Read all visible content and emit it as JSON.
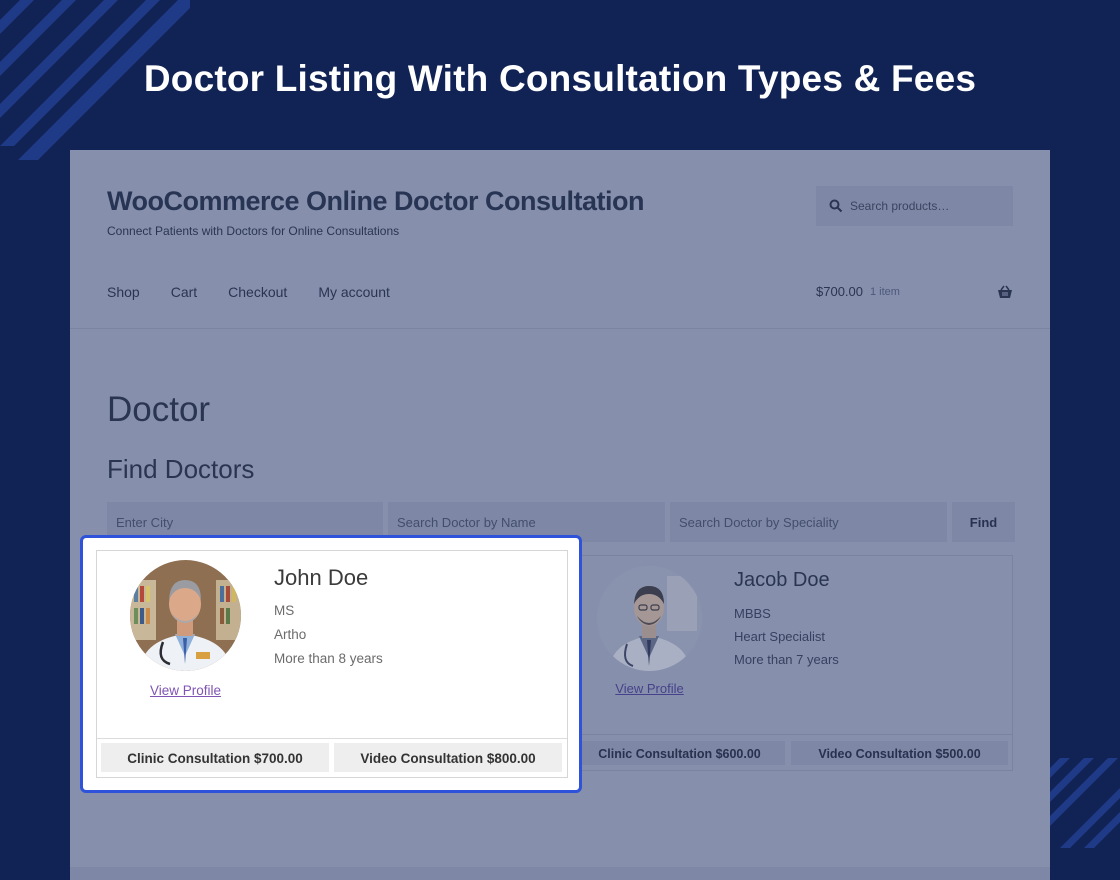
{
  "banner": {
    "title": "Doctor Listing With Consultation Types & Fees"
  },
  "site": {
    "title": "WooCommerce Online Doctor Consultation",
    "tagline": "Connect Patients with Doctors for Online Consultations",
    "search_placeholder": "Search products…"
  },
  "nav": {
    "items": [
      "Shop",
      "Cart",
      "Checkout",
      "My account"
    ]
  },
  "cart": {
    "amount": "$700.00",
    "count": "1 item"
  },
  "page": {
    "title": "Doctor",
    "find_title": "Find Doctors"
  },
  "filters": {
    "city_placeholder": "Enter City",
    "name_placeholder": "Search Doctor by Name",
    "speciality_placeholder": "Search Doctor by Speciality",
    "find_label": "Find"
  },
  "doctors": [
    {
      "name": "John Doe",
      "degree": "MS",
      "speciality": "Artho",
      "experience": "More than 8 years",
      "view_profile": "View Profile",
      "clinic_btn": "Clinic Consultation $700.00",
      "video_btn": "Video Consultation $800.00"
    },
    {
      "name": "Jacob Doe",
      "degree": "MBBS",
      "speciality": "Heart Specialist",
      "experience": "More than 7 years",
      "view_profile": "View Profile",
      "clinic_btn": "Clinic Consultation $600.00",
      "video_btn": "Video Consultation $500.00"
    }
  ],
  "colors": {
    "background": "#112255",
    "highlight_border": "#2e52da",
    "link": "#7f54b3",
    "overlay": "#8690ad"
  }
}
